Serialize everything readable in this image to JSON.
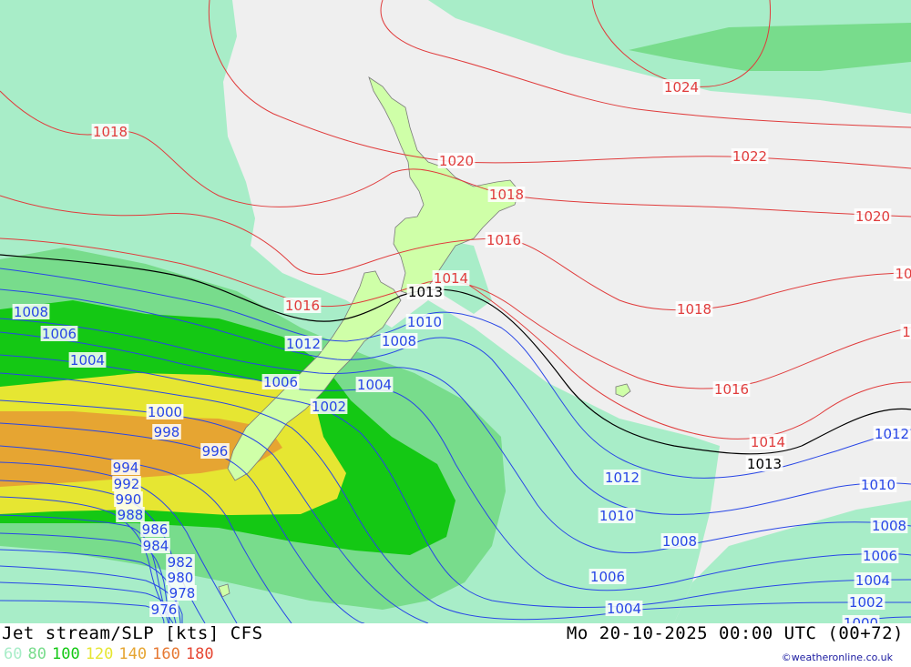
{
  "header": {
    "title": "Jet stream/SLP [kts] CFS",
    "datetime": "Mo 20-10-2025 00:00 UTC (00+72)"
  },
  "legend": {
    "items": [
      {
        "value": "60",
        "color": "#a8edc8"
      },
      {
        "value": "80",
        "color": "#78dc8c"
      },
      {
        "value": "100",
        "color": "#14c814"
      },
      {
        "value": "120",
        "color": "#e6e632"
      },
      {
        "value": "140",
        "color": "#e6a532"
      },
      {
        "value": "160",
        "color": "#e67832"
      },
      {
        "value": "180",
        "color": "#e64632"
      }
    ]
  },
  "credit": "©weatheronline.co.uk",
  "colors": {
    "background": "#efefef",
    "land": "#cfffa8",
    "isobar_high": "#e03c3c",
    "isobar_low": "#2846e6",
    "isobar_ref": "#000000"
  },
  "isobar_labels": [
    {
      "text": "1024",
      "group": "high"
    },
    {
      "text": "1018",
      "group": "high"
    },
    {
      "text": "1020",
      "group": "high"
    },
    {
      "text": "1022",
      "group": "high"
    },
    {
      "text": "1018",
      "group": "high"
    },
    {
      "text": "1020",
      "group": "high"
    },
    {
      "text": "1016",
      "group": "high"
    },
    {
      "text": "1014",
      "group": "high"
    },
    {
      "text": "1016",
      "group": "high"
    },
    {
      "text": "1018",
      "group": "high"
    },
    {
      "text": "10",
      "group": "high"
    },
    {
      "text": "1016",
      "group": "high"
    },
    {
      "text": "1014",
      "group": "high"
    },
    {
      "text": "1",
      "group": "high"
    },
    {
      "text": "1013",
      "group": "ref"
    },
    {
      "text": "1013",
      "group": "ref"
    },
    {
      "text": "1008",
      "group": "low"
    },
    {
      "text": "1006",
      "group": "low"
    },
    {
      "text": "1004",
      "group": "low"
    },
    {
      "text": "1012",
      "group": "low"
    },
    {
      "text": "1010",
      "group": "low"
    },
    {
      "text": "1008",
      "group": "low"
    },
    {
      "text": "1006",
      "group": "low"
    },
    {
      "text": "1004",
      "group": "low"
    },
    {
      "text": "1002",
      "group": "low"
    },
    {
      "text": "1000",
      "group": "low"
    },
    {
      "text": "998",
      "group": "low"
    },
    {
      "text": "996",
      "group": "low"
    },
    {
      "text": "994",
      "group": "low"
    },
    {
      "text": "992",
      "group": "low"
    },
    {
      "text": "990",
      "group": "low"
    },
    {
      "text": "988",
      "group": "low"
    },
    {
      "text": "986",
      "group": "low"
    },
    {
      "text": "984",
      "group": "low"
    },
    {
      "text": "982",
      "group": "low"
    },
    {
      "text": "980",
      "group": "low"
    },
    {
      "text": "978",
      "group": "low"
    },
    {
      "text": "976",
      "group": "low"
    },
    {
      "text": "1012",
      "group": "low"
    },
    {
      "text": "1010",
      "group": "low"
    },
    {
      "text": "1012",
      "group": "low"
    },
    {
      "text": "1010",
      "group": "low"
    },
    {
      "text": "1008",
      "group": "low"
    },
    {
      "text": "1008",
      "group": "low"
    },
    {
      "text": "1006",
      "group": "low"
    },
    {
      "text": "1006",
      "group": "low"
    },
    {
      "text": "1004",
      "group": "low"
    },
    {
      "text": "1004",
      "group": "low"
    },
    {
      "text": "1002",
      "group": "low"
    },
    {
      "text": "1000",
      "group": "low"
    }
  ]
}
